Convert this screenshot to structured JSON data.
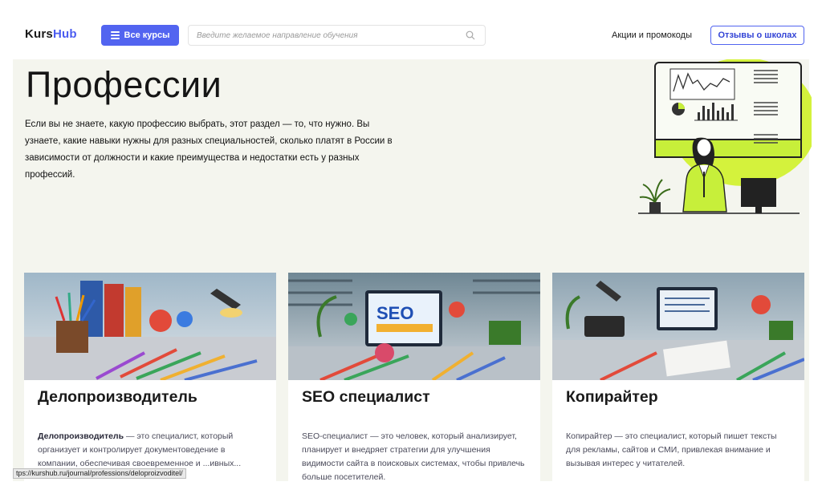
{
  "header": {
    "logo_part1": "Kurs",
    "logo_part2": "Hub",
    "courses_button": "Все курсы",
    "search_placeholder": "Введите желаемое направление обучения",
    "promo_link": "Акции и промокоды",
    "reviews_button": "Отзывы о школах"
  },
  "hero": {
    "title": "Профессии",
    "text": "Если вы не знаете, какую профессию выбрать, этот раздел — то, что нужно. Вы узнаете, какие навыки нужны для разных специальностей, сколько платят в России в зависимости от должности и какие преимущества и недостатки есть у разных профессий."
  },
  "cards": [
    {
      "title": "Делопроизводитель",
      "desc_bold": "Делопроизводитель",
      "desc": " — это специалист, который организует и контролирует документоведение в компании, обеспечивая своевременное и ...ивных..."
    },
    {
      "title": "SEO специалист",
      "desc": "SEO-специалист — это человек, который анализирует, планирует и внедряет стратегии для улучшения видимости сайта в поисковых системах, чтобы привлечь больше посетителей."
    },
    {
      "title": "Копирайтер",
      "desc": "Копирайтер — это специалист, который пишет тексты для рекламы, сайтов и СМИ, привлекая внимание и вызывая интерес у читателей."
    }
  ],
  "status_bar_url": "tps://kurshub.ru/journal/professions/deloproizvoditel/",
  "colors": {
    "accent": "#5264f0",
    "hero_bg": "#f4f5ee",
    "lime": "#c8f23a"
  }
}
